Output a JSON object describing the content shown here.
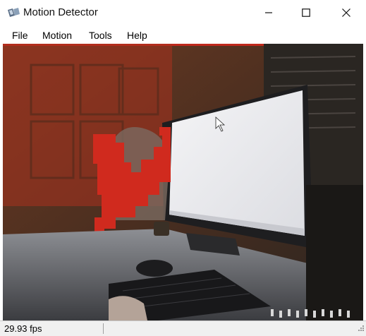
{
  "window": {
    "title": "Motion Detector",
    "app_icon": "camera-icon",
    "controls": {
      "minimize": "minimize-icon",
      "maximize": "maximize-icon",
      "close": "close-icon"
    }
  },
  "menu": {
    "items": [
      {
        "label": "File"
      },
      {
        "label": "Motion"
      },
      {
        "label": "Tools"
      },
      {
        "label": "Help"
      }
    ]
  },
  "video": {
    "description_icon": "live-camera-feed",
    "motion_overlay_color": "#d02a1e"
  },
  "status": {
    "fps_text": "29.93 fps"
  }
}
